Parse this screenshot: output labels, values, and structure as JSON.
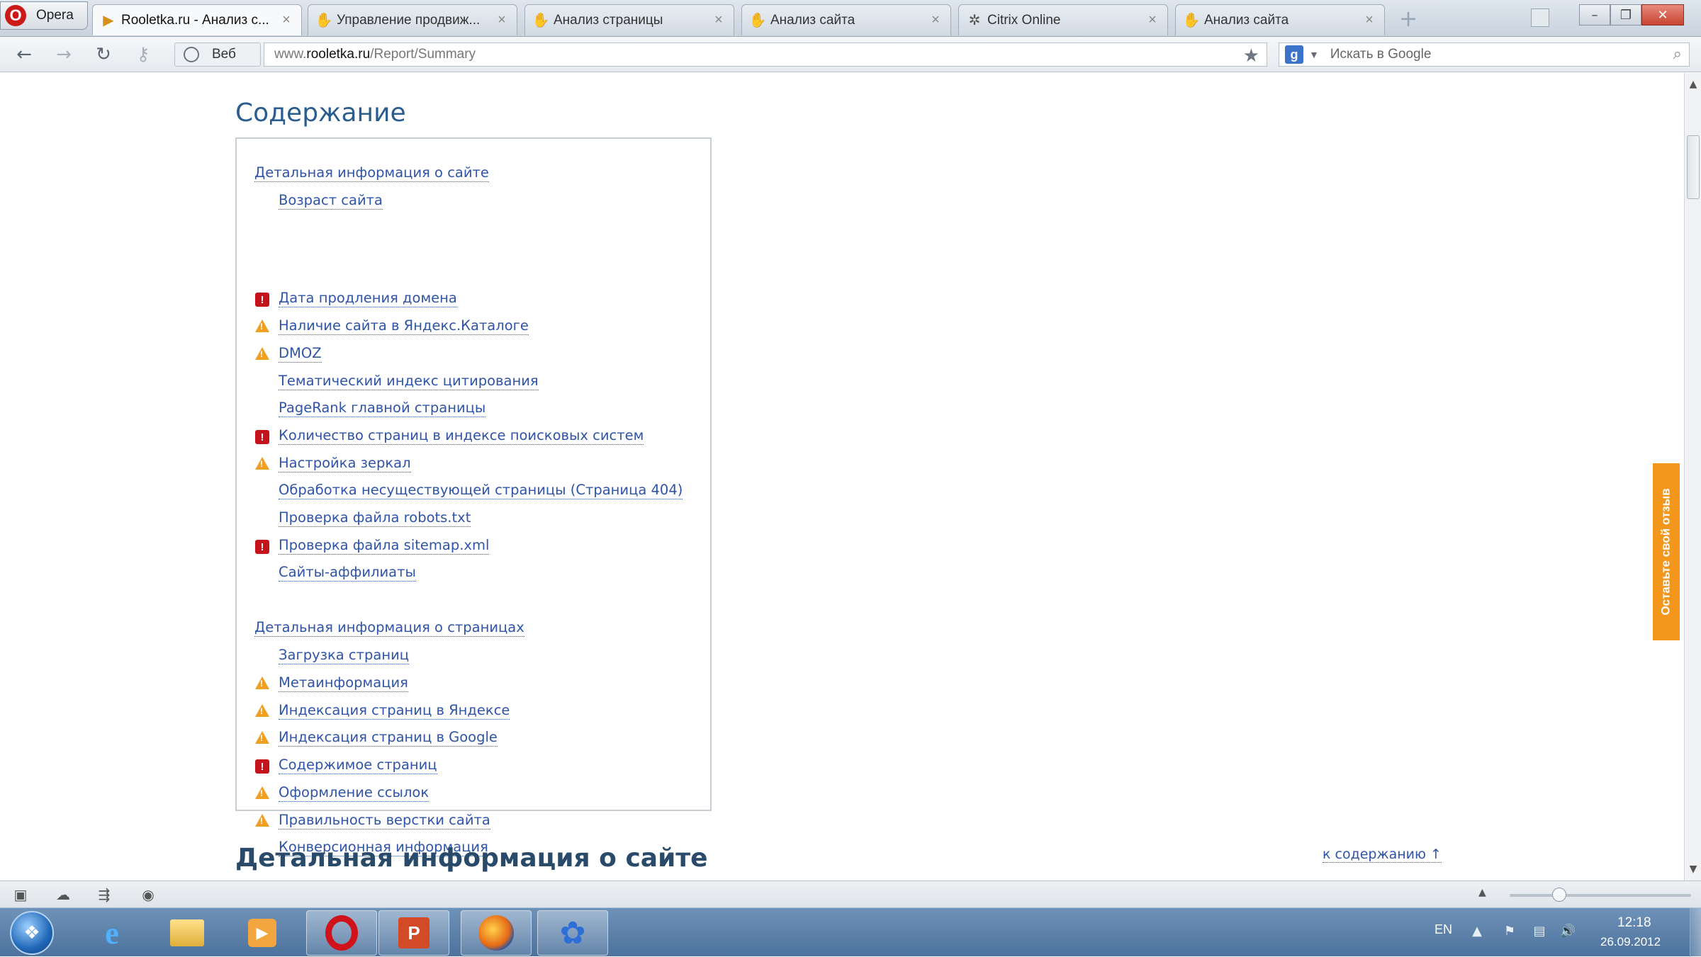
{
  "browser": {
    "menu_label": "Opera",
    "tabs": [
      {
        "label": "Rooletka.ru - Анализ с...",
        "icon": "play-favicon-icon",
        "active": true
      },
      {
        "label": "Управление продвиж...",
        "icon": "hand-favicon-icon",
        "active": false
      },
      {
        "label": "Анализ страницы",
        "icon": "hand-favicon-icon",
        "active": false
      },
      {
        "label": "Анализ сайта",
        "icon": "hand-favicon-icon",
        "active": false
      },
      {
        "label": "Citrix Online",
        "icon": "citrix-favicon-icon",
        "active": false
      },
      {
        "label": "Анализ сайта",
        "icon": "hand-favicon-icon",
        "active": false
      }
    ],
    "web_badge": "Веб",
    "url_prefix": "www.",
    "url_host": "rooletka.ru",
    "url_path": "/Report/Summary",
    "search_placeholder": "Искать в Google"
  },
  "page": {
    "contents_title": "Содержание",
    "toc": {
      "site_section": {
        "title": "Детальная информация о сайте",
        "items": [
          {
            "label": "Возраст сайта",
            "status": "none"
          },
          {
            "label": "Дата продления домена",
            "status": "error"
          },
          {
            "label": "Наличие сайта в Яндекс.Каталоге",
            "status": "warning"
          },
          {
            "label": "DMOZ",
            "status": "warning"
          },
          {
            "label": "Тематический индекс цитирования",
            "status": "none"
          },
          {
            "label": "PageRank главной страницы",
            "status": "none"
          },
          {
            "label": "Количество страниц в индексе поисковых систем",
            "status": "error"
          },
          {
            "label": "Настройка зеркал",
            "status": "warning"
          },
          {
            "label": "Обработка несуществующей страницы (Страница 404)",
            "status": "none"
          },
          {
            "label": "Проверка файла robots.txt",
            "status": "none"
          },
          {
            "label": "Проверка файла sitemap.xml",
            "status": "error"
          },
          {
            "label": "Сайты-аффилиаты",
            "status": "none"
          }
        ]
      },
      "pages_section": {
        "title": "Детальная информация о страницах",
        "items": [
          {
            "label": "Загрузка страниц",
            "status": "none"
          },
          {
            "label": "Метаинформация",
            "status": "warning"
          },
          {
            "label": "Индексация страниц в Яндексе",
            "status": "warning"
          },
          {
            "label": "Индексация страниц в Google",
            "status": "warning"
          },
          {
            "label": "Содержимое страниц",
            "status": "error"
          },
          {
            "label": "Оформление ссылок",
            "status": "warning"
          },
          {
            "label": "Правильность верстки сайта",
            "status": "warning"
          },
          {
            "label": "Конверсионная информация",
            "status": "none"
          }
        ]
      }
    },
    "detail_title": "Детальная информация о сайте",
    "back_to_contents": "к содержанию ↑",
    "feedback_tab": "Оставьте свой отзыв"
  },
  "taskbar": {
    "language": "EN",
    "time": "12:18",
    "date": "26.09.2012"
  },
  "colors": {
    "link": "#2f54a8",
    "heading": "#2a5d8f",
    "error": "#c4131b",
    "warning": "#f0a020",
    "feedback": "#f2961c"
  }
}
